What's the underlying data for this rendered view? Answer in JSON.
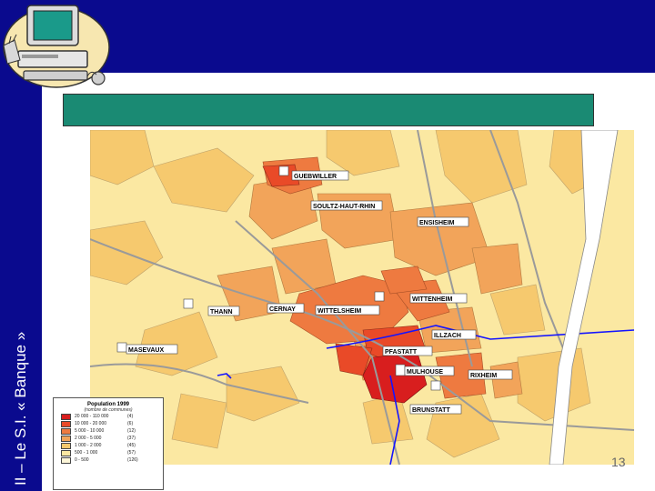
{
  "sidebar": {
    "title": "II – Le S.I. « Banque »"
  },
  "map": {
    "towns": {
      "guebwiller": "GUEBWILLER",
      "soultz": "SOULTZ-HAUT-RHIN",
      "ensisheim": "ENSISHEIM",
      "wittenheim": "WITTENHEIM",
      "thann": "THANN",
      "cernay": "CERNAY",
      "wittelsheim": "WITTELSHEIM",
      "illzach": "ILLZACH",
      "pfastatt": "PFASTATT",
      "masevaux": "MASEVAUX",
      "mulhouse": "MULHOUSE",
      "rixheim": "RIXHEIM",
      "brunstatt": "BRUNSTATT"
    },
    "colors": {
      "lightest": "#fbe8a2",
      "light": "#f6c96e",
      "medium": "#f2a45a",
      "medium_dark": "#ee7a40",
      "dark": "#e94a28",
      "darkest": "#d81e1e",
      "road": "#9a9a9a",
      "water": "#1414ff"
    }
  },
  "legend": {
    "title": "Population 1999",
    "subtitle": "(nombre de communes)",
    "rows": [
      {
        "range": "20 000 - 110 000",
        "count": "(4)",
        "color": "#d81e1e"
      },
      {
        "range": "10 000 - 20 000",
        "count": "(6)",
        "color": "#e94a28"
      },
      {
        "range": "5 000 - 10 000",
        "count": "(12)",
        "color": "#ee7a40"
      },
      {
        "range": "2 000 - 5 000",
        "count": "(37)",
        "color": "#f2a45a"
      },
      {
        "range": "1 000 - 2 000",
        "count": "(45)",
        "color": "#f6c96e"
      },
      {
        "range": "500 - 1 000",
        "count": "(57)",
        "color": "#fbe8a2"
      },
      {
        "range": "0 - 500",
        "count": "(126)",
        "color": "#fdf6d8"
      }
    ]
  },
  "footer": {
    "page_number": "13"
  }
}
